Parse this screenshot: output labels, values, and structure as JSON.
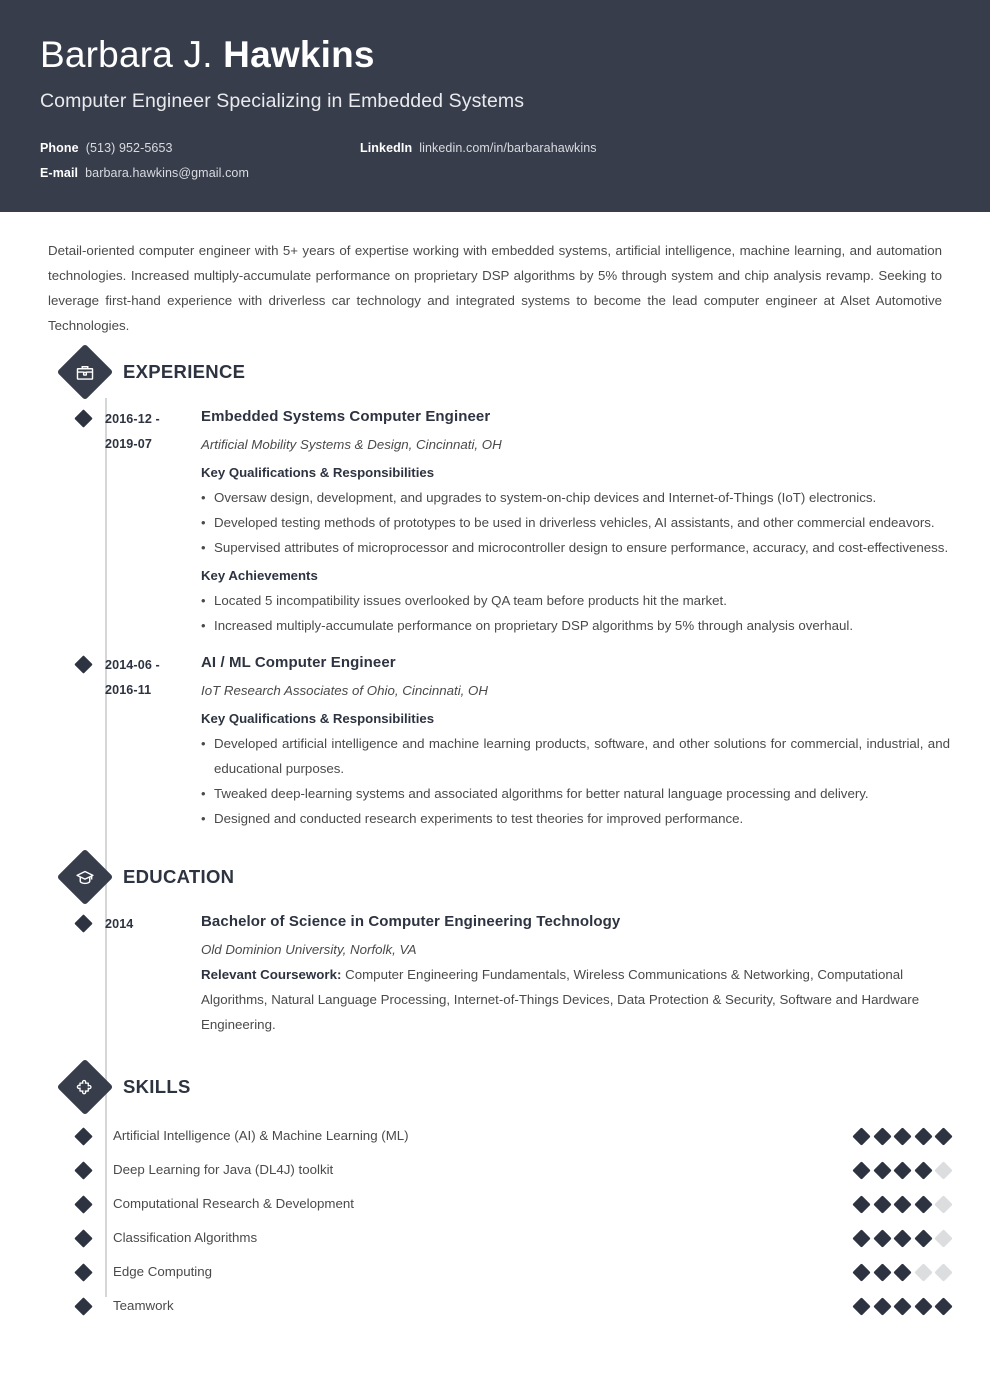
{
  "header": {
    "first_name": "Barbara J. ",
    "last_name": "Hawkins",
    "job_title": "Computer Engineer Specializing in Embedded Systems",
    "contacts": [
      {
        "label": "Phone",
        "value": "(513) 952-5653"
      },
      {
        "label": "LinkedIn",
        "value": "linkedin.com/in/barbarahawkins"
      },
      {
        "label": "E-mail",
        "value": "barbara.hawkins@gmail.com"
      }
    ]
  },
  "summary": "Detail-oriented computer engineer with 5+ years of expertise working with embedded systems, artificial intelligence, machine learning, and automation technologies. Increased multiply-accumulate performance on proprietary DSP algorithms by 5% through system and chip analysis revamp. Seeking to leverage first-hand experience with driverless car technology and integrated systems to become the lead computer engineer at Alset Automotive Technologies.",
  "experience": {
    "section_title": "EXPERIENCE",
    "icon": "briefcase-icon",
    "entries": [
      {
        "date_start": "2016-12 -",
        "date_end": "2019-07",
        "title": "Embedded Systems Computer Engineer",
        "subtitle": "Artificial Mobility Systems & Design, Cincinnati, OH",
        "groups": [
          {
            "heading": "Key Qualifications & Responsibilities",
            "bullets": [
              "Oversaw design, development, and upgrades to system-on-chip devices and Internet-of-Things (IoT) electronics.",
              "Developed testing methods of prototypes to be used in driverless vehicles, AI assistants, and other commercial endeavors.",
              "Supervised attributes of microprocessor and microcontroller design to ensure performance, accuracy, and cost-effectiveness."
            ]
          },
          {
            "heading": "Key Achievements",
            "bullets": [
              "Located 5 incompatibility issues overlooked by QA team before products hit the market.",
              "Increased multiply-accumulate performance on proprietary DSP algorithms by 5% through analysis overhaul."
            ]
          }
        ]
      },
      {
        "date_start": "2014-06 -",
        "date_end": "2016-11",
        "title": "AI / ML Computer Engineer",
        "subtitle": "IoT Research Associates of Ohio, Cincinnati, OH",
        "groups": [
          {
            "heading": "Key Qualifications & Responsibilities",
            "bullets": [
              "Developed artificial intelligence and machine learning products, software, and other solutions for commercial, industrial, and educational purposes.",
              "Tweaked deep-learning systems and associated algorithms for better natural language processing and delivery.",
              "Designed and conducted research experiments to test theories for improved performance."
            ]
          }
        ]
      }
    ]
  },
  "education": {
    "section_title": "EDUCATION",
    "icon": "graduation-cap-icon",
    "entries": [
      {
        "date_start": "2014",
        "title": "Bachelor of Science in Computer Engineering Technology",
        "subtitle": "Old Dominion University, Norfolk, VA",
        "coursework_label": "Relevant Coursework:",
        "coursework": " Computer Engineering Fundamentals, Wireless Communications & Networking, Computational Algorithms, Natural Language Processing, Internet-of-Things Devices, Data Protection & Security, Software and Hardware Engineering."
      }
    ]
  },
  "skills": {
    "section_title": "SKILLS",
    "icon": "puzzle-piece-icon",
    "max_rating": 5,
    "items": [
      {
        "name": "Artificial Intelligence (AI) & Machine Learning (ML)",
        "rating": 5
      },
      {
        "name": "Deep Learning for Java (DL4J) toolkit",
        "rating": 4
      },
      {
        "name": "Computational Research & Development",
        "rating": 4
      },
      {
        "name": "Classification Algorithms",
        "rating": 4
      },
      {
        "name": "Edge Computing",
        "rating": 3
      },
      {
        "name": "Teamwork",
        "rating": 5
      }
    ]
  },
  "colors": {
    "header_bg": "#373d4a",
    "accent_dark": "#2d3340",
    "body_text": "#4a4a4a",
    "timeline": "#d5d6d8",
    "rating_off": "#dcdddf"
  }
}
